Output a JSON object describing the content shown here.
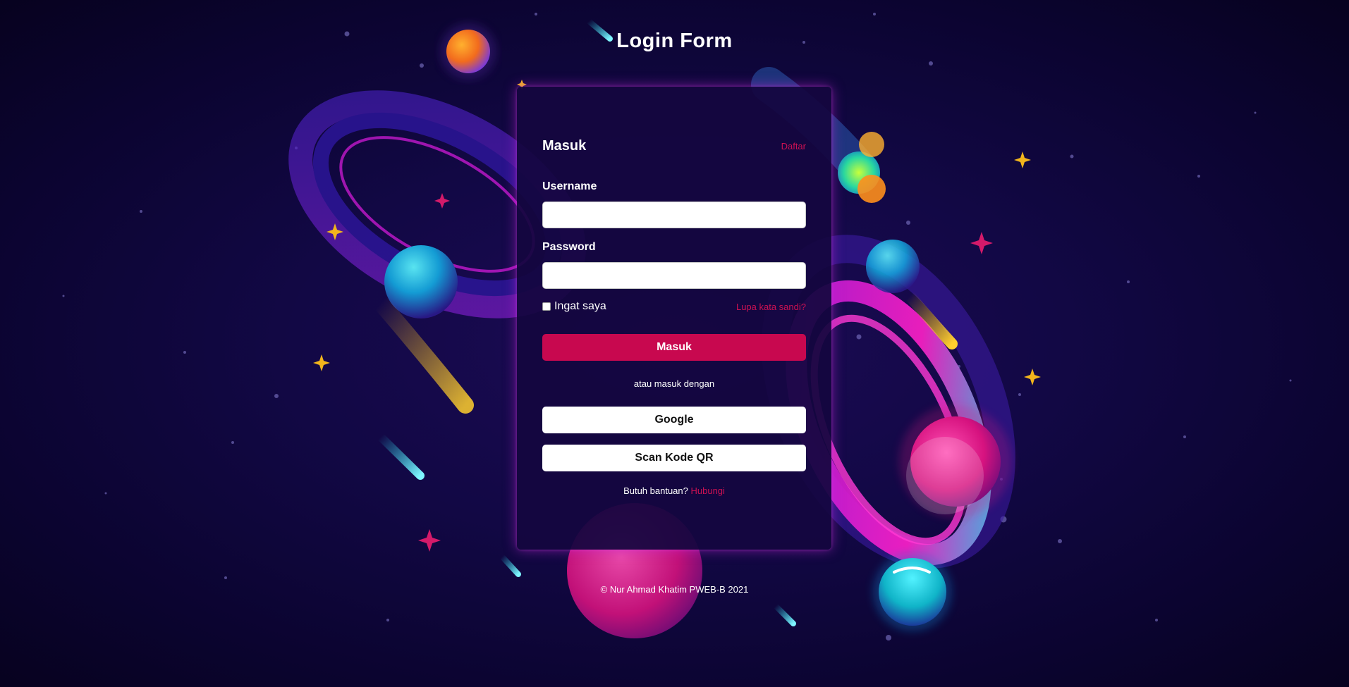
{
  "page": {
    "title": "Login Form",
    "footer": "© Nur Ahmad Khatim PWEB-B 2021"
  },
  "login": {
    "heading": "Masuk",
    "register_link": "Daftar",
    "username_label": "Username",
    "username_value": "",
    "password_label": "Password",
    "password_value": "",
    "remember_label": "Ingat saya",
    "remember_checked": false,
    "forgot_link": "Lupa kata sandi?",
    "submit_label": "Masuk",
    "alt_text": "atau masuk dengan",
    "google_label": "Google",
    "qr_label": "Scan Kode QR",
    "help_text": "Butuh bantuan?",
    "help_link": "Hubungi"
  },
  "colors": {
    "accent": "#c8084f",
    "background": "#0d0533",
    "card": "#140640",
    "planet_magenta": "#e0128e",
    "planet_cyan": "#1ed9f0",
    "star_gold": "#f2b51c"
  },
  "background_decor": [
    "galaxy-illustration",
    "orange-planet",
    "ringed-planet-blue",
    "ringed-planet-magenta",
    "cyan-planet",
    "shooting-stars",
    "sparkle-stars"
  ]
}
